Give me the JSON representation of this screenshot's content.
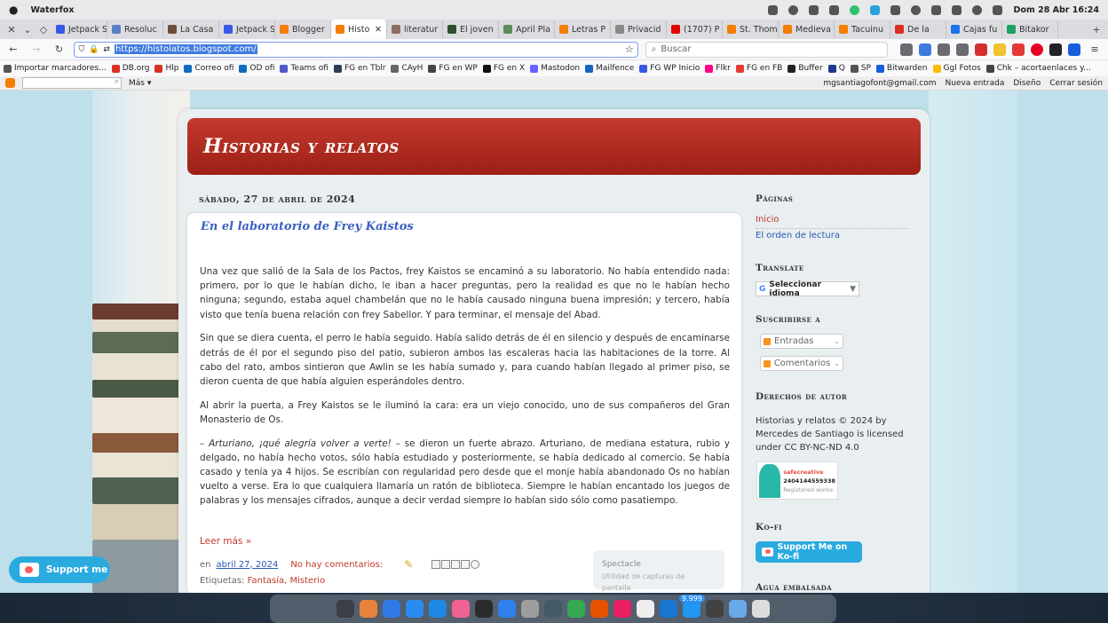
{
  "os_bar": {
    "app_name": "Waterfox",
    "clock": "Dom 28 Abr 16:24",
    "status_icons": [
      "battery-icon",
      "bell-icon",
      "person-icon",
      "refresh-icon",
      "k-icon",
      "telegram-icon",
      "clipboard-icon",
      "bluetooth-icon",
      "volume-icon",
      "chevron-icon",
      "search-icon",
      "grid-icon"
    ]
  },
  "tabs": [
    {
      "label": "Jetpack S",
      "icon": "wordpress-icon",
      "color": "#3858e9"
    },
    {
      "label": "Resoluc",
      "icon": "page-icon",
      "color": "#5b7fc4"
    },
    {
      "label": "La Casa",
      "icon": "image-icon",
      "color": "#6b4d3a"
    },
    {
      "label": "Jetpack S",
      "icon": "wordpress-icon",
      "color": "#3858e9"
    },
    {
      "label": "Blogger",
      "icon": "blogger-icon",
      "color": "#f57d00"
    },
    {
      "label": "Histo",
      "icon": "blogger-icon",
      "color": "#f57d00",
      "active": true
    },
    {
      "label": "literatur",
      "icon": "person-icon",
      "color": "#8d6e63"
    },
    {
      "label": "El joven",
      "icon": "ll-icon",
      "color": "#2e4d2e"
    },
    {
      "label": "April Pla",
      "icon": "w-icon",
      "color": "#5c8d5c"
    },
    {
      "label": "Letras P",
      "icon": "blogger-icon",
      "color": "#f57d00"
    },
    {
      "label": "Privacid",
      "icon": "puzzle-icon",
      "color": "#888888"
    },
    {
      "label": "(1707) P",
      "icon": "youtube-icon",
      "color": "#e00000"
    },
    {
      "label": "St. Thom",
      "icon": "blogger-icon",
      "color": "#f57d00"
    },
    {
      "label": "Medieva",
      "icon": "blogger-icon",
      "color": "#f57d00"
    },
    {
      "label": "Tacuinu",
      "icon": "blogger-icon",
      "color": "#f57d00"
    },
    {
      "label": "De la",
      "icon": "gmail-icon",
      "color": "#d93025"
    },
    {
      "label": "Cajas fu",
      "icon": "u-icon",
      "color": "#1a73e8"
    },
    {
      "label": "Bitakor",
      "icon": "k-icon",
      "color": "#1aa260"
    }
  ],
  "nav": {
    "url": "https://histolatos.blogspot.com/",
    "search_placeholder": "Buscar"
  },
  "bookmarks": [
    {
      "label": "Importar marcadores...",
      "color": "#555555"
    },
    {
      "label": "DB.org",
      "color": "#d93025"
    },
    {
      "label": "Hlp",
      "color": "#d93025"
    },
    {
      "label": "Correo ofi",
      "color": "#0f6cbd"
    },
    {
      "label": "OD ofi",
      "color": "#0f6cbd"
    },
    {
      "label": "Teams ofi",
      "color": "#5059c9"
    },
    {
      "label": "FG en Tblr",
      "color": "#2c3e50"
    },
    {
      "label": "CAyH",
      "color": "#666666"
    },
    {
      "label": "FG en WP",
      "color": "#444444"
    },
    {
      "label": "FG en X",
      "color": "#111111"
    },
    {
      "label": "Mastodon",
      "color": "#6364ff"
    },
    {
      "label": "Mailfence",
      "color": "#1565c0"
    },
    {
      "label": "FG WP Inicio",
      "color": "#3858e9"
    },
    {
      "label": "Flkr",
      "color": "#ff0084"
    },
    {
      "label": "FG en FB",
      "color": "#e53935"
    },
    {
      "label": "Buffer",
      "color": "#222222"
    },
    {
      "label": "Q",
      "color": "#1a3a8a"
    },
    {
      "label": "SP",
      "color": "#555555"
    },
    {
      "label": "Bitwarden",
      "color": "#175ddc"
    },
    {
      "label": "Ggl Fotos",
      "color": "#fbbc04"
    },
    {
      "label": "Chk – acortaenlaces y...",
      "color": "#444444"
    }
  ],
  "blogger_nav": {
    "mas": "Más ▾",
    "email": "mgsantiagofont@gmail.com",
    "new_post": "Nueva entrada",
    "design": "Diseño",
    "signout": "Cerrar sesión"
  },
  "blog": {
    "title": "Historias y relatos",
    "date": "sábado, 27 de abril de 2024",
    "post_title": "En el laboratorio de Frey Kaistos",
    "paragraphs": [
      "Una vez que salió de la Sala de los Pactos, frey Kaistos se encaminó a su laboratorio. No había entendido nada: primero, por lo que le habían dicho, le iban a hacer preguntas, pero la realidad es que no le habían hecho ninguna; segundo, estaba aquel chambelán que no le había causado ninguna buena impresión; y tercero, había visto que tenía buena relación con frey Sabellor. Y para terminar, el mensaje del Abad.",
      "Sin que se diera cuenta, el perro le había seguido. Había salido detrás de él en silencio y después de encaminarse detrás de él por el segundo piso del patio, subieron ambos las escaleras hacia las habitaciones de la torre. Al cabo del rato, ambos sintieron que Awlin se les había sumado y, para cuando habían llegado al primer piso, se dieron cuenta de que había alguien esperándoles dentro.",
      "Al abrir la puerta, a Frey Kaistos se le iluminó la cara: era un viejo conocido, uno de sus compañeros del Gran Monasterio de Os."
    ],
    "quote_em": "– Arturiano, ¡qué alegría volver a verte!",
    "quote_rest": " – se dieron un fuerte abrazo. Arturiano, de mediana estatura, rubio y delgado, no había hecho votos, sólo había estudiado y posteriormente, se había dedicado al comercio. Se había casado y tenía ya 4 hijos. Se escribían con regularidad pero desde que el monje había abandonado Os no habían vuelto a verse. Era lo que cualquiera llamaría un ratón de biblioteca. Siempre le habían encantado los juegos de palabras y los mensajes cifrados, aunque a decir verdad siempre lo habían sido sólo como pasatiempo.",
    "read_more": "Leer más »",
    "meta_prefix": "en",
    "meta_date": "abril 27, 2024",
    "comments": "No hay comentarios:",
    "labels_prefix": "Etiquetas:",
    "labels": "Fantasía, Misterio"
  },
  "sidebar": {
    "pages_title": "Páginas",
    "pages": [
      "Inicio",
      "El orden de lectura"
    ],
    "translate_title": "Translate",
    "translate_select": "Seleccionar idioma",
    "subscribe_title": "Suscribirse a",
    "subscribe_entries": "Entradas",
    "subscribe_comments": "Comentarios",
    "copyright_title": "Derechos de autor",
    "copyright_text": "Historias y relatos © 2024 by Mercedes de Santiago is licensed under CC BY-NC-ND 4.0",
    "safe_brand": "safecreative",
    "safe_code": "2404144559338",
    "safe_sub": "Registered works",
    "kofi_title": "Ko-fi",
    "kofi_button": "Support Me on Ko-fi",
    "next_title": "Agua embalsada"
  },
  "support_button": "Support me",
  "toast": {
    "title": "Spectacle",
    "subtitle": "Utilidad de capturas de pantalla"
  },
  "dock": {
    "badge": "9.999",
    "icons": [
      "terminal-window-icon",
      "apps-grid-icon",
      "finder-icon",
      "xcode-icon",
      "appstore-icon",
      "photos-icon",
      "terminal-icon",
      "notes-icon",
      "safari-icon",
      "camera-icon",
      "sheets-icon",
      "preview-icon",
      "pdf-icon",
      "capture-icon",
      "mail-icon",
      "messages-icon",
      "calculator-icon",
      "folder-icon",
      "trash-icon"
    ],
    "icon_colors": [
      "#3a3f45",
      "#e8823a",
      "#2f7ae5",
      "#2a8cf0",
      "#1e88e5",
      "#f06292",
      "#2b2b2b",
      "#2f80ed",
      "#9e9e9e",
      "#455a64",
      "#34a853",
      "#e65100",
      "#e91e63",
      "#eeeeee",
      "#1976d2",
      "#2196f3",
      "#424242",
      "#6aa9e9",
      "#dddddd"
    ]
  }
}
